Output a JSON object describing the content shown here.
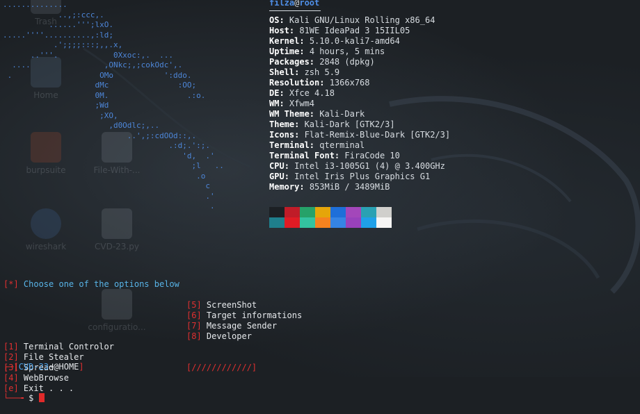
{
  "desktop_icons": [
    {
      "label": "Trash",
      "icon": "trash-icon"
    },
    {
      "label": "Home",
      "icon": "home-folder-icon"
    },
    {
      "label": "burpsuite",
      "icon": "burpsuite-icon"
    },
    {
      "label": "File-With-...",
      "icon": "file-icon"
    },
    {
      "label": "wireshark",
      "icon": "wireshark-icon"
    },
    {
      "label": "CVD-23.py",
      "icon": "python-file-icon"
    },
    {
      "label": "configuratio...",
      "icon": "config-file-icon"
    }
  ],
  "ascii_logo": "..............\n            ..,;:ccc,.\n          ......''';lxO.\n.....''''..........,:ld;\n           .';;;;:::;,,.x,\n      ..'''.            0Xxoc:,.  ...\n  ....                ,ONkc;,;cokOdc',.\n .                   OMo           ':ddo.\n                    dMc               :OO;\n                    0M.                 .:o.\n                    ;Wd\n                     ;XO,\n                       ,d0Odlc;,..\n                           ..',;:cdOOd::,.\n                                    .:d;.':;.\n                                       'd,  .'\n                                         ;l   ..\n                                          .o\n                                            c\n                                            .'\n                                             .",
  "neofetch": {
    "user": "filza",
    "at": "@",
    "host": "root",
    "rows": [
      {
        "key": "OS",
        "value": "Kali GNU/Linux Rolling x86_64"
      },
      {
        "key": "Host",
        "value": "81WE IdeaPad 3 15IIL05"
      },
      {
        "key": "Kernel",
        "value": "5.10.0-kali7-amd64"
      },
      {
        "key": "Uptime",
        "value": "4 hours, 5 mins"
      },
      {
        "key": "Packages",
        "value": "2848 (dpkg)"
      },
      {
        "key": "Shell",
        "value": "zsh 5.9"
      },
      {
        "key": "Resolution",
        "value": "1366x768"
      },
      {
        "key": "DE",
        "value": "Xfce 4.18"
      },
      {
        "key": "WM",
        "value": "Xfwm4"
      },
      {
        "key": "WM Theme",
        "value": "Kali-Dark"
      },
      {
        "key": "Theme",
        "value": "Kali-Dark [GTK2/3]"
      },
      {
        "key": "Icons",
        "value": "Flat-Remix-Blue-Dark [GTK2/3]"
      },
      {
        "key": "Terminal",
        "value": "qterminal"
      },
      {
        "key": "Terminal Font",
        "value": "FiraCode 10"
      },
      {
        "key": "CPU",
        "value": "Intel i3-1005G1 (4) @ 3.400GHz"
      },
      {
        "key": "GPU",
        "value": "Intel Iris Plus Graphics G1"
      },
      {
        "key": "Memory",
        "value": "853MiB / 3489MiB"
      }
    ],
    "palette_top": [
      "#1c2024",
      "#c01c28",
      "#26a269",
      "#e5a50a",
      "#1e6fd9",
      "#a347ba",
      "#2aa1b3",
      "#d0cfcc"
    ],
    "palette_bottom": [
      "#1f7f8c",
      "#e01b24",
      "#33c3a0",
      "#f5821f",
      "#3584e4",
      "#9841bb",
      "#1fa0e8",
      "#f6f5f4"
    ]
  },
  "menu": {
    "prompt_mark": "[*]",
    "prompt_text": " Choose one of the options below",
    "options_left": [
      {
        "num": "[1]",
        "label": " Terminal Controlor"
      },
      {
        "num": "[2]",
        "label": " File Stealer"
      },
      {
        "num": "[3]",
        "label": " Spread"
      },
      {
        "num": "[4]",
        "label": " WebBrowse"
      },
      {
        "num": "[e]",
        "label": " Exit . . ."
      }
    ],
    "options_right": [
      {
        "num": "[5]",
        "label": " ScreenShot"
      },
      {
        "num": "[6]",
        "label": " Target informations"
      },
      {
        "num": "[7]",
        "label": " Message Sender"
      },
      {
        "num": "[8]",
        "label": " Developer"
      }
    ],
    "divider": "[////////////]"
  },
  "shell_prompt": {
    "line1_open": "┌─[",
    "name": "CVD-23",
    "at_home": "~@HOME",
    "line1_close": "]",
    "line2_arrow": "└──╼",
    "dollar": " $ "
  }
}
